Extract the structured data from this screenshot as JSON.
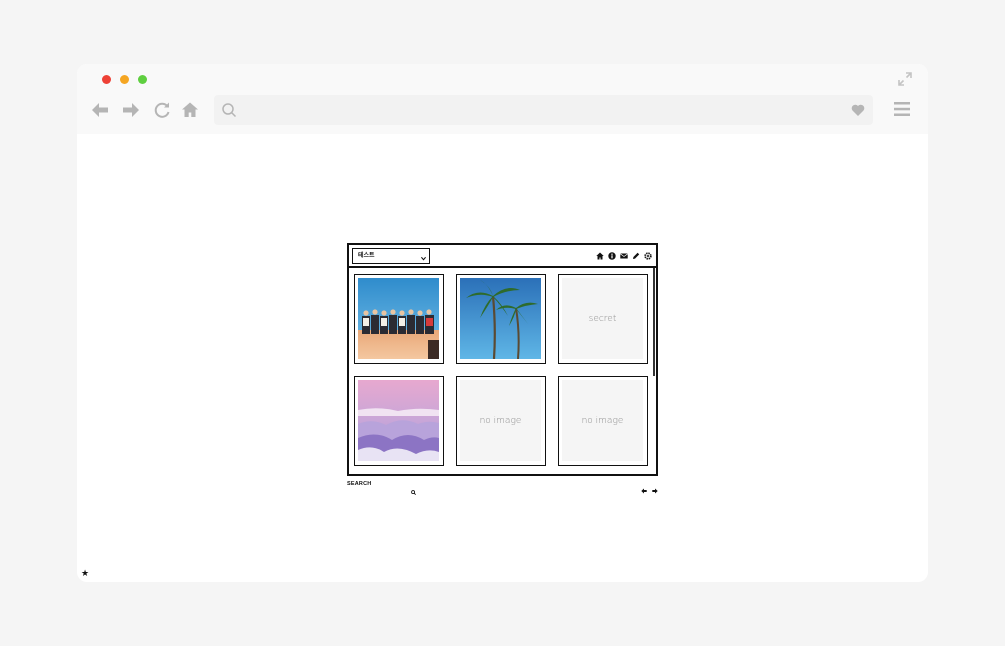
{
  "browser": {
    "traffic_lights": {
      "close": "#ee4136",
      "minimize": "#f5a623",
      "maximize": "#5fcf40"
    },
    "icons": {
      "expand": "expand-icon",
      "back": "arrow-left-icon",
      "forward": "arrow-right-icon",
      "reload": "reload-icon",
      "home": "home-icon",
      "search": "search-icon",
      "favorite": "heart-icon",
      "menu": "hamburger-menu-icon"
    },
    "address": {
      "value": "",
      "placeholder": ""
    }
  },
  "page": {
    "marker": "★"
  },
  "widget": {
    "category_select": {
      "value": "테스트"
    },
    "toolbar_icons": [
      "home-icon",
      "info-icon",
      "mail-icon",
      "pencil-icon",
      "gear-icon"
    ],
    "tiles": [
      {
        "kind": "photo",
        "subject": "group-on-wall-photo"
      },
      {
        "kind": "photo",
        "subject": "palm-trees-photo"
      },
      {
        "kind": "text",
        "label": "secret"
      },
      {
        "kind": "photo",
        "subject": "purple-mountains-photo"
      },
      {
        "kind": "text",
        "label": "no image"
      },
      {
        "kind": "text",
        "label": "no image"
      }
    ],
    "footer": {
      "search_label": "SEARCH",
      "icons": [
        "search-icon",
        "prev-arrow-icon",
        "next-arrow-icon"
      ]
    }
  }
}
